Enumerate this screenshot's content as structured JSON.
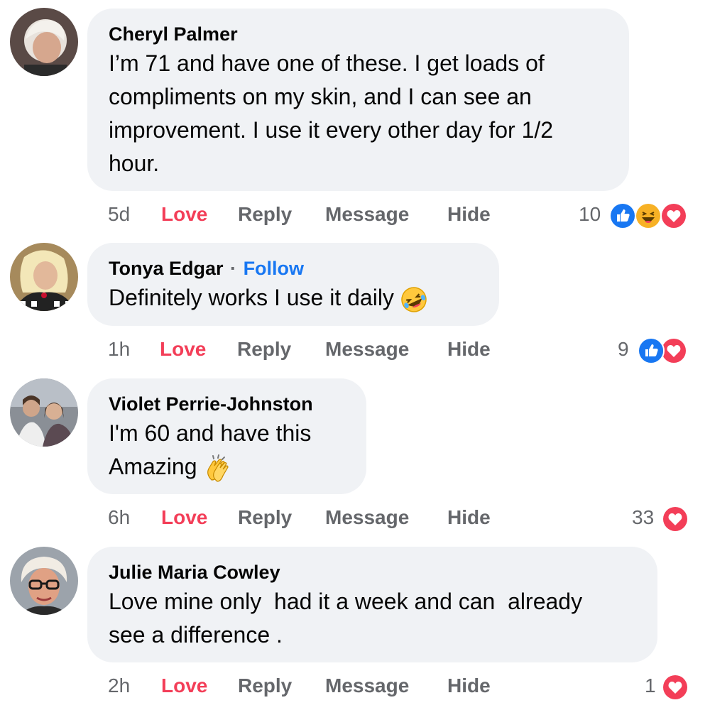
{
  "comments": [
    {
      "name": "Cheryl Palmer",
      "text_lines": [
        "I’m 71 and have one of these. I get loads of",
        "compliments on my skin, and I can see an",
        "improvement. I use it every other day for 1/2",
        "hour."
      ],
      "time": "5d",
      "reaction_count": "10",
      "reactions": [
        "like-icon",
        "haha-icon",
        "love-icon"
      ]
    },
    {
      "name": "Tonya Edgar",
      "follow_separator": "·",
      "follow_label": "Follow",
      "text_lines": [
        "Definitely works I use it daily"
      ],
      "emoji": "rofl-emoji",
      "time": "1h",
      "reaction_count": "9",
      "reactions": [
        "like-icon",
        "love-icon"
      ]
    },
    {
      "name": "Violet Perrie-Johnston",
      "text_lines": [
        "I'm 60 and have this",
        "Amazing"
      ],
      "emoji": "clapping-hands-emoji",
      "time": "6h",
      "reaction_count": "33",
      "reactions": [
        "love-icon"
      ]
    },
    {
      "name": "Julie Maria Cowley",
      "text_lines": [
        "Love mine only  had it a week and can  already",
        "see a difference ."
      ],
      "time": "2h",
      "reaction_count": "1",
      "reactions": [
        "love-icon"
      ]
    }
  ],
  "actions": {
    "love": "Love",
    "reply": "Reply",
    "message": "Message",
    "hide": "Hide"
  },
  "colors": {
    "bubble": "#f0f2f5",
    "love": "#f33e58",
    "link": "#1877f2",
    "muted": "#65676b",
    "like_blue": "#1877f2",
    "love_red": "#f33e58"
  }
}
